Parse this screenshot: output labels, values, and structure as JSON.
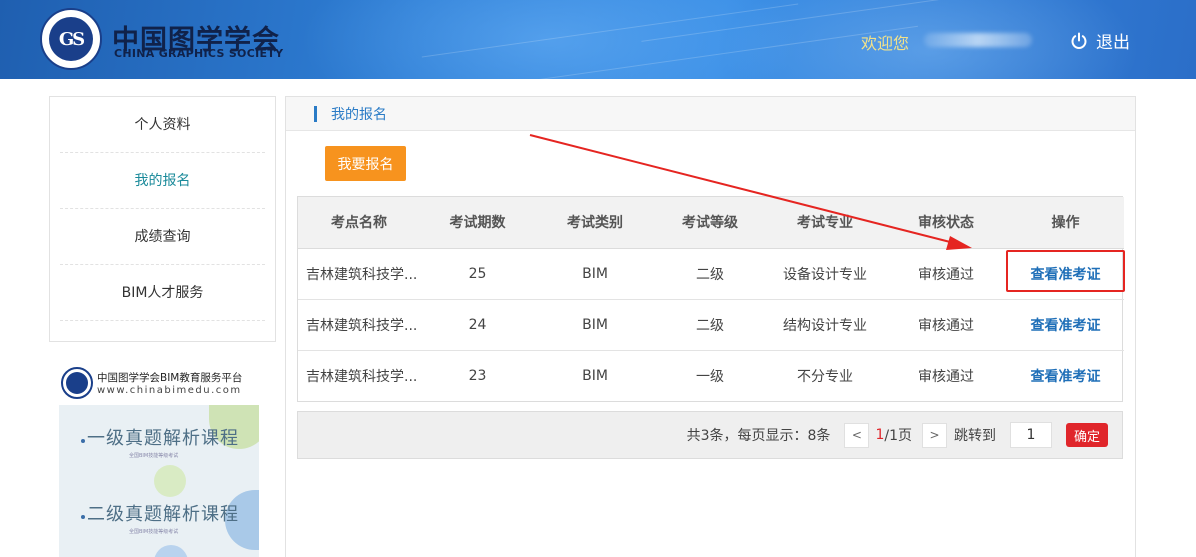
{
  "header": {
    "logo_text": "中国图学学会",
    "logo_subtitle": "CHINA GRAPHICS SOCIETY",
    "welcome": "欢迎您",
    "logout_label": "退出",
    "logout_icon": "power-icon"
  },
  "sidebar": {
    "items": [
      {
        "label": "个人资料"
      },
      {
        "label": "我的报名"
      },
      {
        "label": "成绩查询"
      },
      {
        "label": "BIM人才服务"
      }
    ],
    "active_index": 1,
    "banner": {
      "title": "中国图学学会BIM教育服务平台",
      "url": "www.chinabimedu.com",
      "course1": "一级真题解析课程",
      "course2": "二级真题解析课程",
      "course_sub": "全国BIM技能等级考试"
    }
  },
  "main": {
    "section_title": "我的报名",
    "signup_button": "我要报名",
    "table": {
      "headers": [
        "考点名称",
        "考试期数",
        "考试类别",
        "考试等级",
        "考试专业",
        "审核状态",
        "操作"
      ],
      "rows": [
        {
          "site": "吉林建筑科技学...",
          "period": "25",
          "category": "BIM",
          "level": "二级",
          "major": "设备设计专业",
          "status": "审核通过",
          "action": "查看准考证"
        },
        {
          "site": "吉林建筑科技学...",
          "period": "24",
          "category": "BIM",
          "level": "二级",
          "major": "结构设计专业",
          "status": "审核通过",
          "action": "查看准考证"
        },
        {
          "site": "吉林建筑科技学...",
          "period": "23",
          "category": "BIM",
          "level": "一级",
          "major": "不分专业",
          "status": "审核通过",
          "action": "查看准考证"
        }
      ]
    },
    "pager": {
      "summary": "共3条，每页显示：8条",
      "prev": "<",
      "current": "1",
      "total": "/1页",
      "next": ">",
      "jump_label": "跳转到",
      "jump_value": "1",
      "confirm": "确定"
    }
  },
  "colors": {
    "accent": "#2a7bc6",
    "orange": "#f7931e",
    "red": "#e0262b",
    "annotation": "#e52521"
  }
}
